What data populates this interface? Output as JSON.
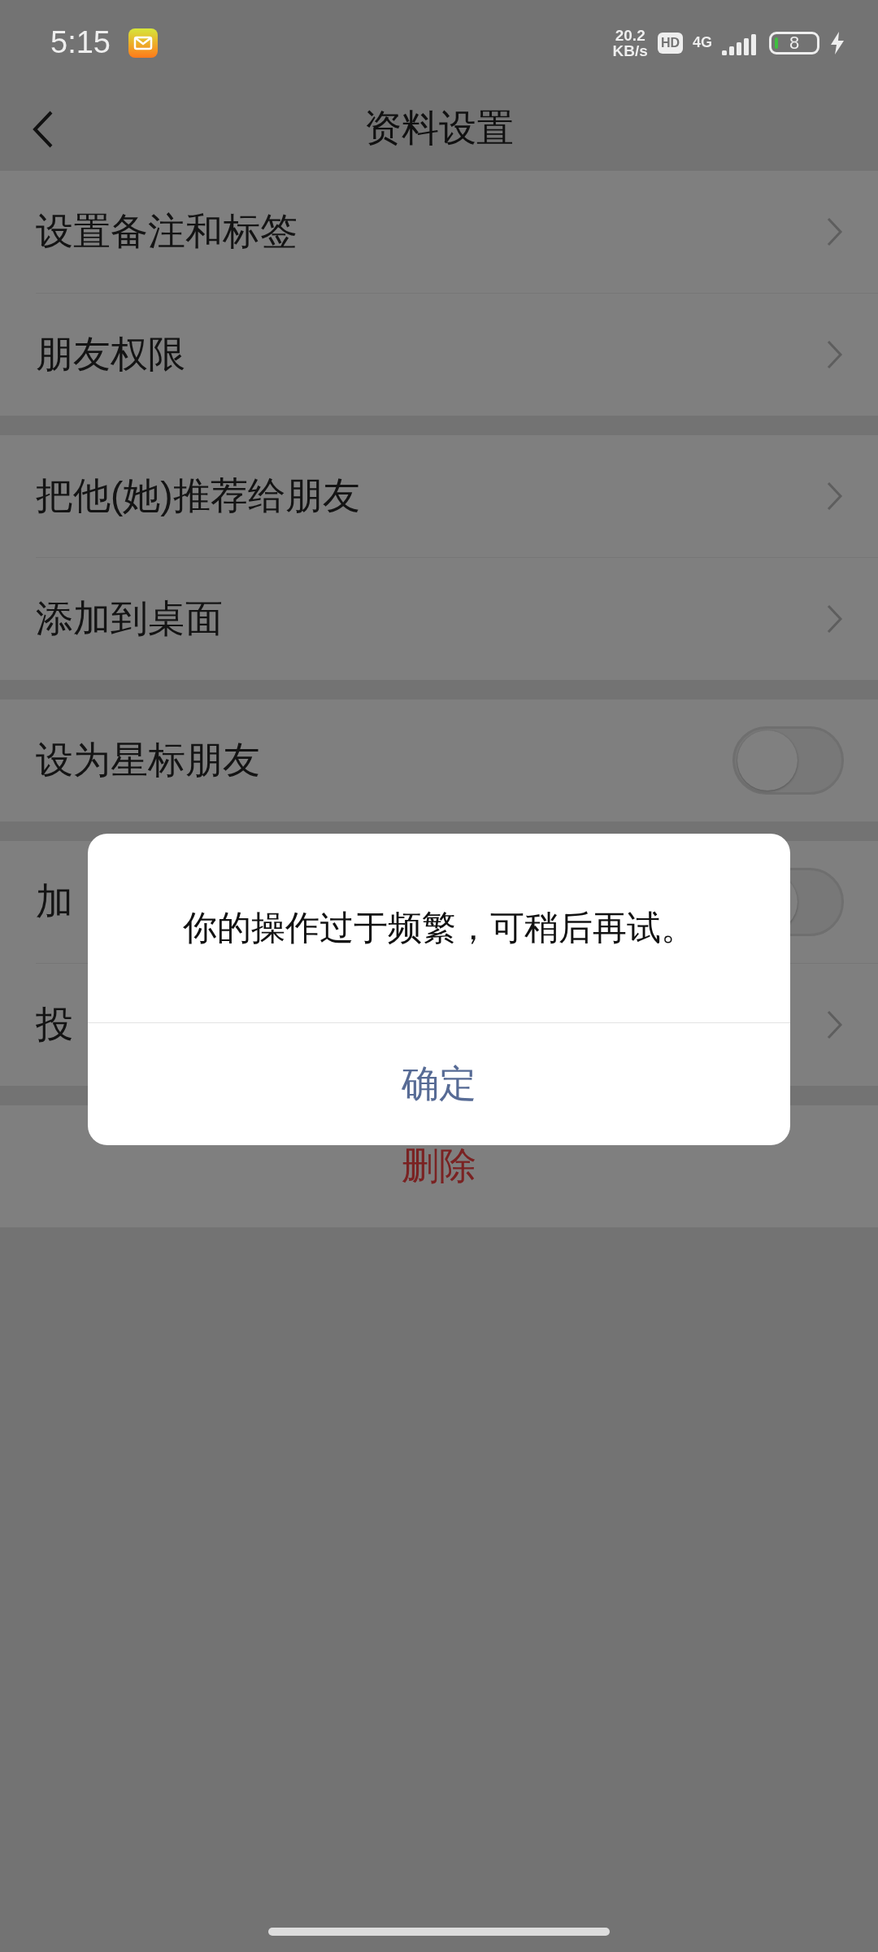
{
  "status_bar": {
    "time": "5:15",
    "net_speed": "20.2",
    "net_unit": "KB/s",
    "hd": "HD",
    "network": "4G",
    "battery": "8"
  },
  "nav": {
    "title": "资料设置"
  },
  "groups": [
    [
      {
        "kind": "link",
        "label": "设置备注和标签"
      },
      {
        "kind": "link",
        "label": "朋友权限"
      }
    ],
    [
      {
        "kind": "link",
        "label": "把他(她)推荐给朋友"
      },
      {
        "kind": "link",
        "label": "添加到桌面"
      }
    ],
    [
      {
        "kind": "toggle",
        "label": "设为星标朋友",
        "on": false
      }
    ],
    [
      {
        "kind": "toggle",
        "label": "加",
        "on": false
      },
      {
        "kind": "link",
        "label": "投"
      }
    ]
  ],
  "delete": {
    "label": "删除"
  },
  "dialog": {
    "message": "你的操作过于频繁，可稍后再试。",
    "button": "确定"
  }
}
